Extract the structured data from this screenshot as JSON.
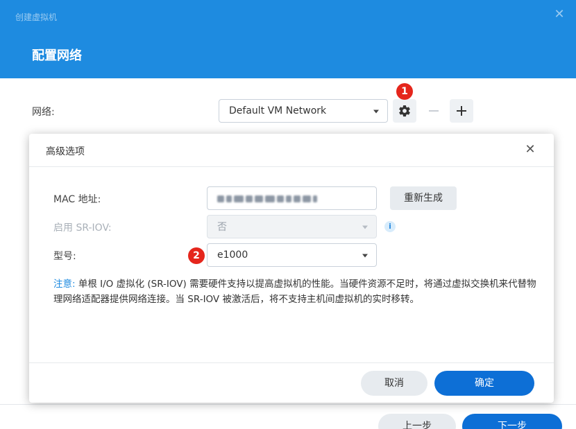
{
  "window": {
    "title": "创建虚拟机",
    "close_glyph": "✕"
  },
  "page": {
    "heading": "配置网络"
  },
  "network": {
    "label": "网络:",
    "selected": "Default VM Network",
    "icons": [
      "gear-icon",
      "minus-icon",
      "plus-icon"
    ]
  },
  "badges": {
    "first": "1",
    "second": "2"
  },
  "modal": {
    "title": "高级选项",
    "close_glyph": "✕",
    "mac": {
      "label": "MAC 地址:",
      "regenerate_label": "重新生成"
    },
    "sriov": {
      "label": "启用 SR-IOV:",
      "selected": "否",
      "info_glyph": "i"
    },
    "model": {
      "label": "型号:",
      "selected": "e1000"
    },
    "note": {
      "prefix": "注意:",
      "text": " 单根 I/O 虚拟化 (SR-IOV) 需要硬件支持以提高虚拟机的性能。当硬件资源不足时，将通过虚拟交换机来代替物理网络适配器提供网络连接。当 SR-IOV 被激活后，将不支持主机间虚拟机的实时移转。"
    },
    "buttons": {
      "cancel": "取消",
      "ok": "确定"
    }
  },
  "footer": {
    "prev": "上一步",
    "next": "下一步"
  },
  "colors": {
    "header": "#1e8be0",
    "primary_button": "#0d6fd6",
    "badge": "#e5261c",
    "note_accent": "#1e8be0"
  }
}
